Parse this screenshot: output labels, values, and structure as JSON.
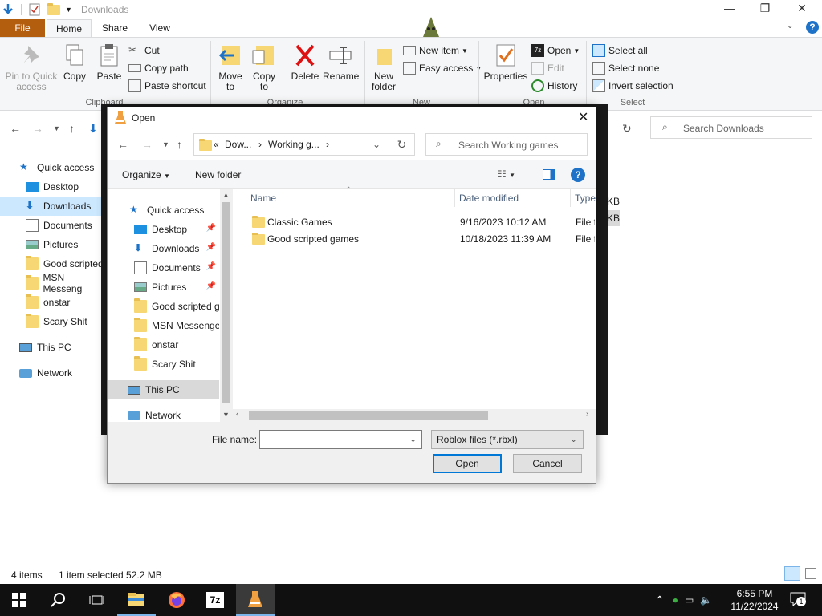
{
  "explorer": {
    "window_title": "Downloads",
    "tabs": {
      "file": "File",
      "home": "Home",
      "share": "Share",
      "view": "View"
    },
    "ribbon": {
      "pin": "Pin to Quick access",
      "copy": "Copy",
      "paste": "Paste",
      "cut": "Cut",
      "copy_path": "Copy path",
      "paste_shortcut": "Paste shortcut",
      "clipboard_group": "Clipboard",
      "move_to": "Move to",
      "copy_to": "Copy to",
      "delete": "Delete",
      "rename": "Rename",
      "organize_group": "Organize",
      "new_folder": "New folder",
      "new_item": "New item",
      "easy_access": "Easy access",
      "new_group": "New",
      "properties": "Properties",
      "open": "Open",
      "edit": "Edit",
      "history": "History",
      "open_group": "Open",
      "select_all": "Select all",
      "select_none": "Select none",
      "invert_selection": "Invert selection",
      "select_group": "Select"
    },
    "search_placeholder": "Search Downloads",
    "sidebar": [
      {
        "label": "Quick access",
        "icon": "star-icon"
      },
      {
        "label": "Desktop",
        "icon": "desktop-icon"
      },
      {
        "label": "Downloads",
        "icon": "download-icon"
      },
      {
        "label": "Documents",
        "icon": "document-icon"
      },
      {
        "label": "Pictures",
        "icon": "pictures-icon"
      },
      {
        "label": "Good scripted",
        "icon": "folder-icon"
      },
      {
        "label": "MSN Messeng",
        "icon": "folder-icon"
      },
      {
        "label": "onstar",
        "icon": "folder-icon"
      },
      {
        "label": "Scary Shit",
        "icon": "folder-icon"
      },
      {
        "label": "This PC",
        "icon": "pc-icon"
      },
      {
        "label": "Network",
        "icon": "network-icon"
      }
    ],
    "size_fragment_1": "KB",
    "size_fragment_2": "KB",
    "status_count": "4 items",
    "status_selected": "1 item selected  52.2 MB"
  },
  "dialog": {
    "title": "Open",
    "breadcrumb_prefix": "«",
    "breadcrumb_1": "Dow...",
    "breadcrumb_2": "Working g...",
    "search_placeholder": "Search Working games",
    "organize": "Organize",
    "new_folder": "New folder",
    "nav": [
      {
        "label": "Quick access",
        "icon": "star-icon",
        "pinned": false
      },
      {
        "label": "Desktop",
        "icon": "desktop-icon",
        "pinned": true
      },
      {
        "label": "Downloads",
        "icon": "download-icon",
        "pinned": true
      },
      {
        "label": "Documents",
        "icon": "document-icon",
        "pinned": true
      },
      {
        "label": "Pictures",
        "icon": "pictures-icon",
        "pinned": true
      },
      {
        "label": "Good scripted g",
        "icon": "folder-icon",
        "pinned": false
      },
      {
        "label": "MSN Messenger",
        "icon": "folder-icon",
        "pinned": false
      },
      {
        "label": "onstar",
        "icon": "folder-icon",
        "pinned": false
      },
      {
        "label": "Scary Shit",
        "icon": "folder-icon",
        "pinned": false
      },
      {
        "label": "This PC",
        "icon": "pc-icon",
        "pinned": false
      },
      {
        "label": "Network",
        "icon": "network-icon",
        "pinned": false
      }
    ],
    "columns": {
      "name": "Name",
      "date": "Date modified",
      "type": "Type"
    },
    "files": [
      {
        "name": "Classic Games",
        "date": "9/16/2023 10:12 AM",
        "type": "File fo"
      },
      {
        "name": "Good scripted games",
        "date": "10/18/2023 11:39 AM",
        "type": "File fo"
      }
    ],
    "file_name_label": "File name:",
    "file_name_value": "",
    "file_type": "Roblox files (*.rbxl)",
    "open_button": "Open",
    "cancel_button": "Cancel"
  },
  "taskbar": {
    "time": "6:55 PM",
    "date": "11/22/2024",
    "notification_count": "1"
  }
}
